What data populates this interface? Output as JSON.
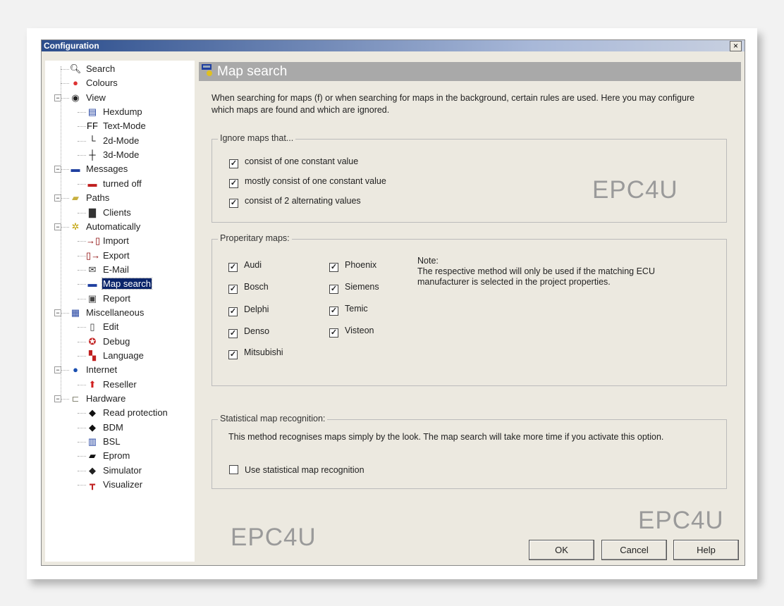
{
  "window": {
    "title": "Configuration",
    "close_label": "×"
  },
  "tree": [
    {
      "label": "Search",
      "icon": "magnifier-icon",
      "level": 0,
      "glyph": "🔍︎",
      "color": "#000"
    },
    {
      "label": "Colours",
      "icon": "colours-icon",
      "level": 0,
      "glyph": "●",
      "color": "#d33"
    },
    {
      "label": "View",
      "icon": "eye-icon",
      "level": 0,
      "expander": "−",
      "glyph": "◉",
      "color": "#222"
    },
    {
      "label": "Hexdump",
      "icon": "hexdump-icon",
      "level": 1,
      "glyph": "▤",
      "color": "#2040a0"
    },
    {
      "label": "Text-Mode",
      "icon": "text-mode-icon",
      "level": 1,
      "glyph": "FF",
      "color": "#000"
    },
    {
      "label": "2d-Mode",
      "icon": "2d-axes-icon",
      "level": 1,
      "glyph": "└",
      "color": "#000"
    },
    {
      "label": "3d-Mode",
      "icon": "3d-axes-icon",
      "level": 1,
      "glyph": "┼",
      "color": "#000"
    },
    {
      "label": "Messages",
      "icon": "messages-icon",
      "level": 0,
      "expander": "−",
      "glyph": "▬",
      "color": "#2040a0"
    },
    {
      "label": "turned off",
      "icon": "messages-off-icon",
      "level": 1,
      "glyph": "▬",
      "color": "#c02020"
    },
    {
      "label": "Paths",
      "icon": "folder-icon",
      "level": 0,
      "expander": "−",
      "glyph": "▰",
      "color": "#c8b040"
    },
    {
      "label": "Clients",
      "icon": "top-hat-icon",
      "level": 1,
      "glyph": "▇",
      "color": "#333"
    },
    {
      "label": "Automatically",
      "icon": "automation-gear-icon",
      "level": 0,
      "expander": "−",
      "glyph": "✲",
      "color": "#c0a000"
    },
    {
      "label": "Import",
      "icon": "import-icon",
      "level": 1,
      "glyph": "→▯",
      "color": "#800"
    },
    {
      "label": "Export",
      "icon": "export-icon",
      "level": 1,
      "glyph": "▯→",
      "color": "#800"
    },
    {
      "label": "E-Mail",
      "icon": "email-icon",
      "level": 1,
      "glyph": "✉",
      "color": "#333"
    },
    {
      "label": "Map search",
      "icon": "map-search-icon",
      "level": 1,
      "glyph": "▬",
      "color": "#2040a0",
      "selected": true
    },
    {
      "label": "Report",
      "icon": "report-clipboard-icon",
      "level": 1,
      "glyph": "▣",
      "color": "#444"
    },
    {
      "label": "Miscellaneous",
      "icon": "miscellaneous-icon",
      "level": 0,
      "expander": "−",
      "glyph": "▦",
      "color": "#2040a0"
    },
    {
      "label": "Edit",
      "icon": "edit-icon",
      "level": 1,
      "glyph": "▯",
      "color": "#333"
    },
    {
      "label": "Debug",
      "icon": "debug-icon",
      "level": 1,
      "glyph": "✪",
      "color": "#c02020"
    },
    {
      "label": "Language",
      "icon": "flag-icon",
      "level": 1,
      "glyph": "▚",
      "color": "#c02020"
    },
    {
      "label": "Internet",
      "icon": "globe-icon",
      "level": 0,
      "expander": "−",
      "glyph": "●",
      "color": "#1a4fb0"
    },
    {
      "label": "Reseller",
      "icon": "reseller-icon",
      "level": 1,
      "glyph": "⬆",
      "color": "#d02020"
    },
    {
      "label": "Hardware",
      "icon": "plug-icon",
      "level": 0,
      "expander": "−",
      "glyph": "⊏",
      "color": "#887"
    },
    {
      "label": "Read protection",
      "icon": "chip-icon",
      "level": 1,
      "glyph": "◆",
      "color": "#111"
    },
    {
      "label": "BDM",
      "icon": "chip-icon",
      "level": 1,
      "glyph": "◆",
      "color": "#111"
    },
    {
      "label": "BSL",
      "icon": "bsl-icon",
      "level": 1,
      "glyph": "▥",
      "color": "#2040a0"
    },
    {
      "label": "Eprom",
      "icon": "eprom-icon",
      "level": 1,
      "glyph": "▰",
      "color": "#111"
    },
    {
      "label": "Simulator",
      "icon": "simulator-icon",
      "level": 1,
      "glyph": "◆",
      "color": "#222"
    },
    {
      "label": "Visualizer",
      "icon": "visualizer-icon",
      "level": 1,
      "glyph": "┳",
      "color": "#c02020"
    }
  ],
  "panel": {
    "title": "Map search",
    "description": "When searching for maps (f) or when searching for maps in the background, certain rules are used. Here you may configure which maps are found and which are ignored.",
    "ignore_group": {
      "title": "Ignore maps that...",
      "options": [
        {
          "label": "consist of one constant value",
          "checked": true
        },
        {
          "label": "mostly consist of one constant value",
          "checked": true
        },
        {
          "label": "consist of 2 alternating values",
          "checked": true
        }
      ]
    },
    "proprietary_group": {
      "title": "Properitary maps:",
      "col1": [
        {
          "label": "Audi",
          "checked": true
        },
        {
          "label": "Bosch",
          "checked": true
        },
        {
          "label": "Delphi",
          "checked": true
        },
        {
          "label": "Denso",
          "checked": true
        },
        {
          "label": "Mitsubishi",
          "checked": true
        }
      ],
      "col2": [
        {
          "label": "Phoenix",
          "checked": true
        },
        {
          "label": "Siemens",
          "checked": true
        },
        {
          "label": "Temic",
          "checked": true
        },
        {
          "label": "Visteon",
          "checked": true
        }
      ],
      "note_title": "Note:",
      "note_text": "The respective method will only be used if the matching ECU manufacturer is selected in the project properties."
    },
    "statistical_group": {
      "title": "Statistical map recognition:",
      "description": "This method recognises maps simply by the look. The map search will take more time if you activate this option.",
      "option": {
        "label": "Use statistical map recognition",
        "checked": false
      }
    }
  },
  "watermark": "EPC4U",
  "buttons": {
    "ok": "OK",
    "cancel": "Cancel",
    "help": "Help"
  },
  "check_mark": "✓"
}
